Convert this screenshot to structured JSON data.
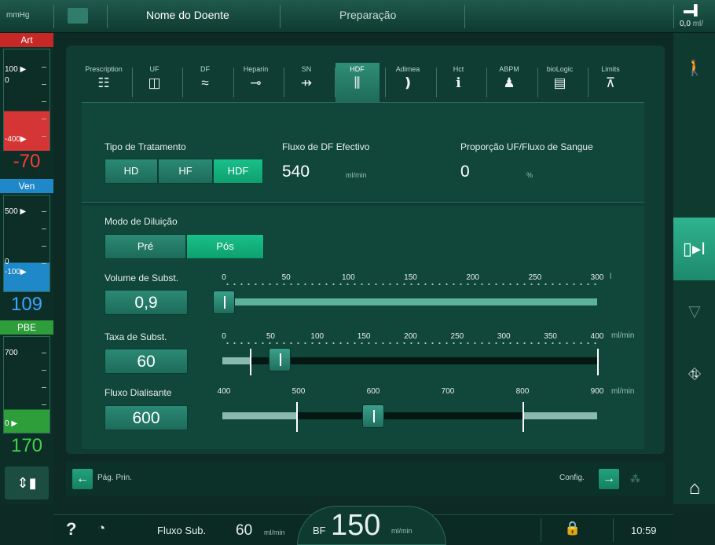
{
  "header": {
    "unit_label": "mmHg",
    "patient_name": "Nome do Doente",
    "phase": "Preparação",
    "top_right_value": "0,0",
    "top_right_unit": "ml/"
  },
  "pressures": {
    "art": {
      "label": "Art",
      "upper": "100 ▶",
      "lower_zero": "0",
      "lower": "-400▶",
      "value": "-70"
    },
    "ven": {
      "label": "Ven",
      "upper": "500 ▶",
      "lower_zero": "0",
      "lower": "-100▶",
      "value": "109"
    },
    "pbe": {
      "label": "PBE",
      "upper": "700",
      "lower": "0 ▶",
      "value": "170"
    }
  },
  "tabs": [
    {
      "label": "Prescription",
      "icon": "sliders-icon"
    },
    {
      "label": "UF",
      "icon": "uf-filter-icon"
    },
    {
      "label": "DF",
      "icon": "dialysate-wave-icon"
    },
    {
      "label": "Heparin",
      "icon": "syringe-icon"
    },
    {
      "label": "SN",
      "icon": "single-needle-icon"
    },
    {
      "label": "HDF",
      "icon": "hdf-icon"
    },
    {
      "label": "Adimea",
      "icon": "adimea-signal-icon"
    },
    {
      "label": "Hct",
      "icon": "hct-drops-icon"
    },
    {
      "label": "ABPM",
      "icon": "patient-bp-icon"
    },
    {
      "label": "bioLogic",
      "icon": "biologic-icon"
    },
    {
      "label": "Limits",
      "icon": "limits-icon"
    }
  ],
  "active_tab": "HDF",
  "treatment": {
    "type_label": "Tipo de Tratamento",
    "options": [
      "HD",
      "HF",
      "HDF"
    ],
    "selected": "HDF",
    "df_flow_label": "Fluxo de DF Efectivo",
    "df_flow_value": "540",
    "df_flow_unit": "ml/min",
    "ratio_label": "Proporção UF/Fluxo de Sangue",
    "ratio_value": "0",
    "ratio_unit": "%"
  },
  "dilution": {
    "label": "Modo de Diluição",
    "options": [
      "Pré",
      "Pós"
    ],
    "selected": "Pós"
  },
  "subst_volume": {
    "label": "Volume de Subst.",
    "value": "0,9",
    "scale": [
      "0",
      "50",
      "100",
      "150",
      "200",
      "250",
      "300"
    ],
    "unit": "l",
    "slider_value": 0
  },
  "subst_rate": {
    "label": "Taxa de Subst.",
    "value": "60",
    "scale": [
      "0",
      "50",
      "100",
      "150",
      "200",
      "250",
      "300",
      "350",
      "400"
    ],
    "unit": "ml/min",
    "slider_value": 60
  },
  "dialysate_flow": {
    "label": "Fluxo Dialisante",
    "value": "600",
    "scale": [
      "400",
      "500",
      "600",
      "700",
      "800",
      "900"
    ],
    "unit": "ml/min",
    "slider_value": 600
  },
  "nav": {
    "back_label": "Pág. Prin.",
    "config_label": "Config."
  },
  "status": {
    "sub_label": "Fluxo Sub.",
    "sub_value": "60",
    "sub_unit": "ml/min",
    "bf_label": "BF",
    "bf_value": "150",
    "bf_unit": "ml/min",
    "time": "10:59"
  },
  "colors": {
    "art": "#c62828",
    "ven": "#1e88c8",
    "pbe": "#2e9e3a",
    "accent": "#10b07c"
  }
}
